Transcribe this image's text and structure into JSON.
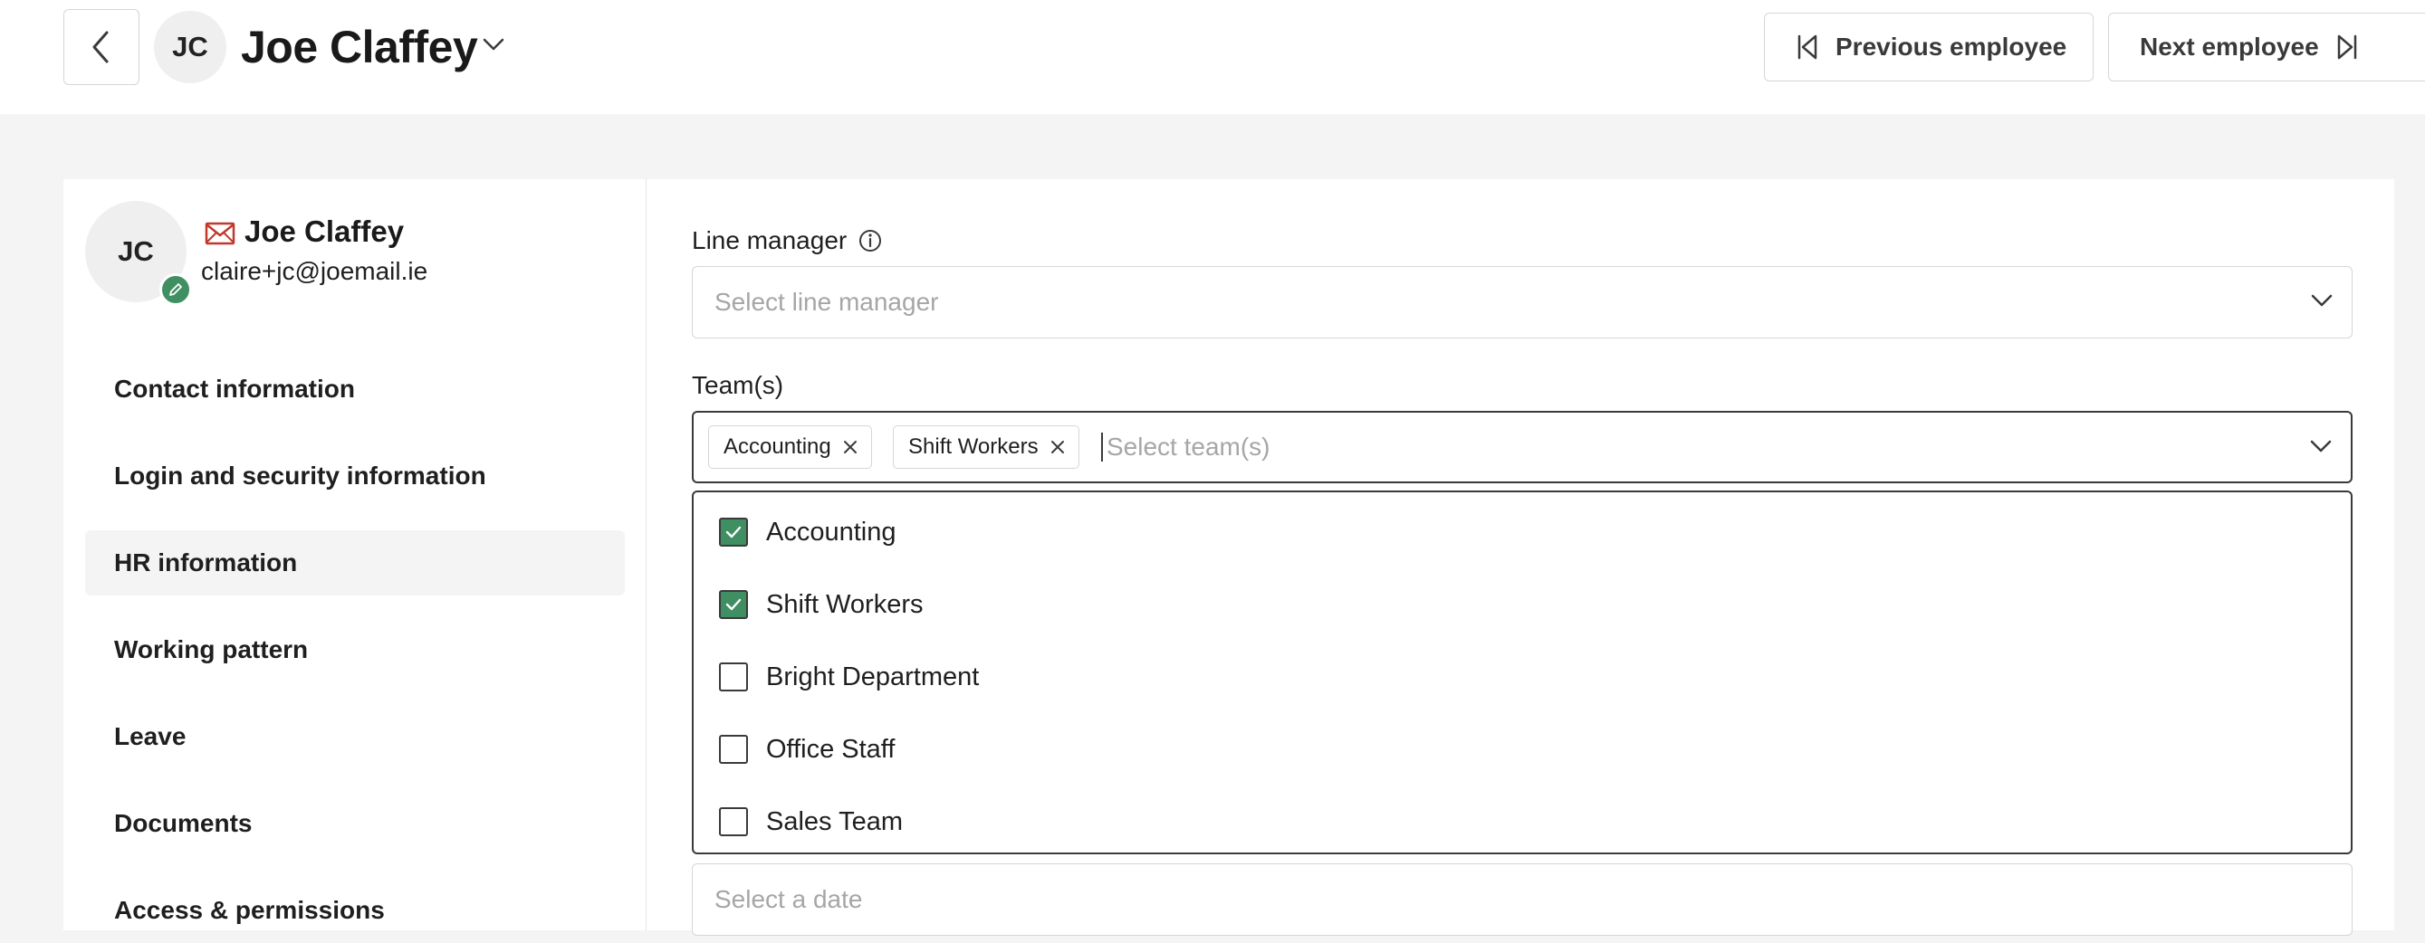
{
  "header": {
    "avatar_initials": "JC",
    "employee_name": "Joe Claffey",
    "prev_label": "Previous employee",
    "next_label": "Next employee"
  },
  "profile": {
    "initials": "JC",
    "name": "Joe Claffey",
    "email": "claire+jc@joemail.ie"
  },
  "sidebar": {
    "items": [
      {
        "label": "Contact information"
      },
      {
        "label": "Login and security information"
      },
      {
        "label": "HR information"
      },
      {
        "label": "Working pattern"
      },
      {
        "label": "Leave"
      },
      {
        "label": "Documents"
      },
      {
        "label": "Access & permissions"
      }
    ],
    "active_index": 2
  },
  "form": {
    "line_manager": {
      "label": "Line manager",
      "placeholder": "Select line manager"
    },
    "teams": {
      "label": "Team(s)",
      "placeholder": "Select team(s)",
      "selected": [
        "Accounting",
        "Shift Workers"
      ]
    },
    "date": {
      "placeholder": "Select a date"
    }
  },
  "dropdown": {
    "options": [
      {
        "label": "Accounting",
        "checked": true
      },
      {
        "label": "Shift Workers",
        "checked": true
      },
      {
        "label": "Bright Department",
        "checked": false
      },
      {
        "label": "Office Staff",
        "checked": false
      },
      {
        "label": "Sales Team",
        "checked": false
      }
    ]
  },
  "colors": {
    "accent_green": "#3f8f62",
    "mail_red": "#c0392b"
  }
}
